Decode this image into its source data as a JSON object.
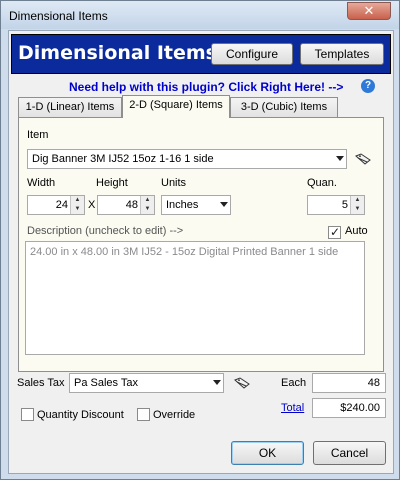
{
  "window": {
    "title": "Dimensional Items",
    "close_glyph": "✕"
  },
  "banner": {
    "title": "Dimensional Items",
    "configure_label": "Configure",
    "templates_label": "Templates",
    "help_text": "Need help with this plugin?  Click Right Here! -->",
    "help_icon": "question-icon",
    "help_glyph": "?"
  },
  "tabs": [
    {
      "label": "1-D (Linear) Items",
      "active": false
    },
    {
      "label": "2-D (Square) Items",
      "active": true
    },
    {
      "label": "3-D (Cubic) Items",
      "active": false
    }
  ],
  "item": {
    "label": "Item",
    "value": "Dig Banner 3M IJ52 15oz 1-16 1 side"
  },
  "dimensions": {
    "width_label": "Width",
    "width_value": "24",
    "x_label": "X",
    "height_label": "Height",
    "height_value": "48",
    "units_label": "Units",
    "units_value": "Inches",
    "quan_label": "Quan.",
    "quan_value": "5"
  },
  "description": {
    "label": "Description (uncheck to edit) -->",
    "auto_label": "Auto",
    "auto_checked": true,
    "text": "24.00 in x 48.00 in 3M IJ52 - 15oz Digital Printed  Banner 1 side"
  },
  "sales_tax": {
    "label": "Sales Tax",
    "value": "Pa Sales Tax"
  },
  "options": {
    "quantity_discount_label": "Quantity Discount",
    "quantity_discount_checked": false,
    "override_label": "Override",
    "override_checked": false
  },
  "pricing": {
    "each_label": "Each",
    "each_value": "48",
    "total_label": "Total",
    "total_value": "$240.00"
  },
  "footer": {
    "ok_label": "OK",
    "cancel_label": "Cancel"
  },
  "colors": {
    "banner_bg": "#0b2b9c",
    "help_link": "#0000cc",
    "tab_panel_bg": "#fbfbf1"
  }
}
